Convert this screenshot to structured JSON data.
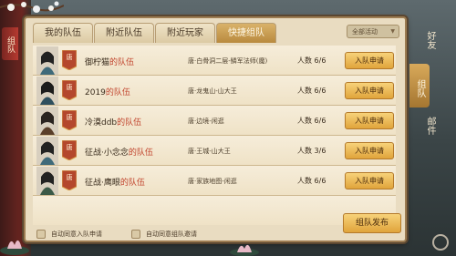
{
  "tabs": [
    {
      "label": "我的队伍"
    },
    {
      "label": "附近队伍"
    },
    {
      "label": "附近玩家"
    },
    {
      "label": "快捷组队"
    }
  ],
  "active_tab": 3,
  "filter": {
    "label": "全部活动",
    "icon": "chevron-down-icon"
  },
  "side_label": "组队",
  "teams": [
    {
      "leader": "御柠猫",
      "suffix": "的队伍",
      "badge": "唐",
      "location": "唐·白骨洞二层-鳞军法师(魔)",
      "count": "人数 6/6",
      "button": "入队申请"
    },
    {
      "leader": "2019",
      "suffix": "的队伍",
      "badge": "唐",
      "location": "唐·龙鬼山-山大王",
      "count": "人数 6/6",
      "button": "入队申请"
    },
    {
      "leader": "冷漠ddb",
      "suffix": "的队伍",
      "badge": "唐",
      "location": "唐·边境-闲逛",
      "count": "人数 6/6",
      "button": "入队申请"
    },
    {
      "leader": "征战·小念念",
      "suffix": "的队伍",
      "badge": "唐",
      "location": "唐·王城-山大王",
      "count": "人数 3/6",
      "button": "入队申请"
    },
    {
      "leader": "征战·鹰眼",
      "suffix": "的队伍",
      "badge": "唐",
      "location": "唐·家族地图-闲逛",
      "count": "人数 6/6",
      "button": "入队申请"
    }
  ],
  "bottom": {
    "auto_accept_join": "自动同意入队申请",
    "auto_accept_invite": "自动同意组队邀请",
    "publish_button": "组队发布"
  },
  "right_nav": {
    "friends": "好友",
    "team": "组队",
    "mail": "邮件"
  },
  "colors": {
    "panel_bg": "#e9dcc1",
    "active_tab": "#c79a4f",
    "button_gold": "#eab54f",
    "team_suffix": "#c1432c"
  }
}
